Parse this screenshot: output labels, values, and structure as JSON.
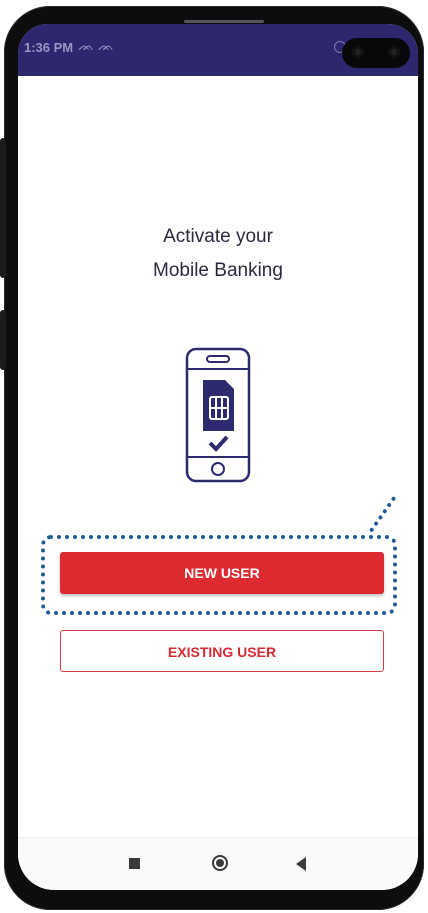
{
  "status_bar": {
    "time": "1:36 PM",
    "notification_icons": "ᨏ ᨏ"
  },
  "main": {
    "title_line1": "Activate your",
    "title_line2": "Mobile Banking",
    "illustration": "phone-sim-verified-icon"
  },
  "buttons": {
    "new_user": "NEW USER",
    "existing_user": "EXISTING USER"
  },
  "nav_bar": {
    "recents": "square-icon",
    "home": "circle-icon",
    "back": "triangle-back-icon"
  },
  "colors": {
    "status_bar": "#2d2770",
    "primary_red": "#dc2a30",
    "illustration_navy": "#2d2a6e",
    "callout_blue": "#1f5a94"
  }
}
